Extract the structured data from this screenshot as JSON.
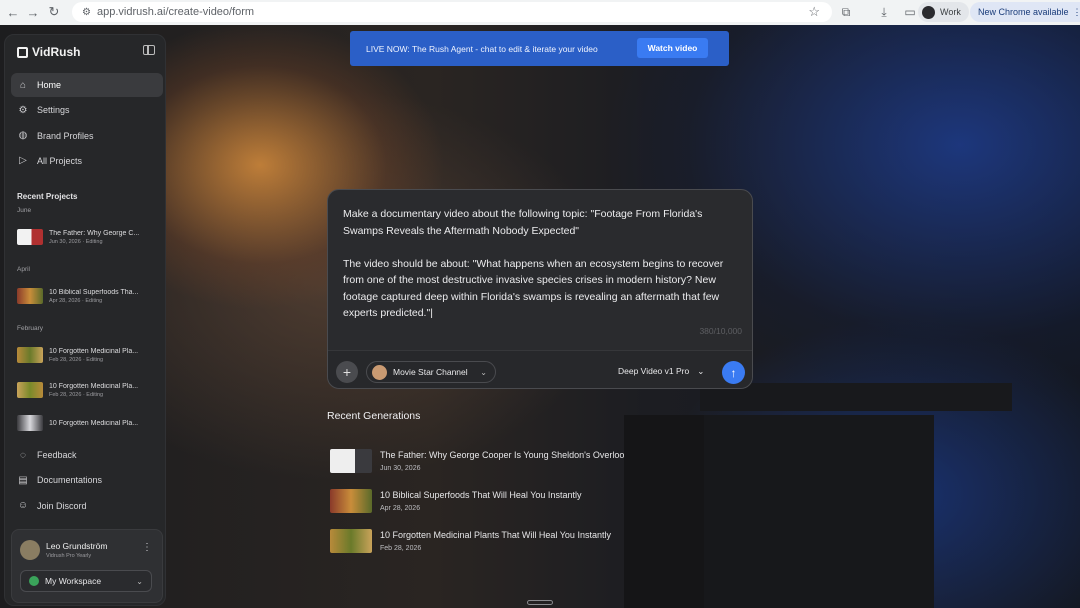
{
  "browser": {
    "url": "app.vidrush.ai/create-video/form",
    "profile_label": "Work",
    "update_label": "New Chrome available"
  },
  "sidebar": {
    "brand": "VidRush",
    "nav": [
      {
        "label": "Home",
        "icon": "home-icon"
      },
      {
        "label": "Settings",
        "icon": "gear-icon"
      },
      {
        "label": "Brand Profiles",
        "icon": "palette-icon"
      },
      {
        "label": "All Projects",
        "icon": "play-circle-icon"
      }
    ],
    "recent_title": "Recent Projects",
    "groups": [
      {
        "month": "June",
        "items": [
          {
            "name": "The Father: Why George C...",
            "meta": "Jun 30, 2026 · Editing"
          }
        ]
      },
      {
        "month": "April",
        "items": [
          {
            "name": "10 Biblical Superfoods Tha...",
            "meta": "Apr 28, 2026 · Editing"
          }
        ]
      },
      {
        "month": "February",
        "items": [
          {
            "name": "10 Forgotten Medicinal Pla...",
            "meta": "Feb 28, 2026 · Editing"
          },
          {
            "name": "10 Forgotten Medicinal Pla...",
            "meta": "Feb 28, 2026 · Editing"
          },
          {
            "name": "10 Forgotten Medicinal Pla...",
            "meta": ""
          }
        ]
      }
    ],
    "bottom_nav": [
      {
        "label": "Feedback",
        "icon": "chat-icon"
      },
      {
        "label": "Documentations",
        "icon": "document-icon"
      },
      {
        "label": "Join Discord",
        "icon": "discord-icon"
      }
    ],
    "user": {
      "name": "Leo Grundström",
      "plan": "Vidrush Pro Yearly",
      "workspace": "My Workspace"
    }
  },
  "banner": {
    "text": "LIVE NOW: The Rush Agent - chat to edit & iterate your video",
    "button": "Watch video"
  },
  "prompt": {
    "text": "Make a documentary video about the following topic: \"Footage From Florida's Swamps Reveals the Aftermath Nobody Expected\"\n\nThe video should be about: \"What happens when an ecosystem begins to recover from one of the most destructive invasive species crises in modern history? New footage captured deep within Florida's swamps is revealing an aftermath that few experts predicted.\"|",
    "counter": "380/10,000",
    "channel": "Movie Star Channel",
    "model": "Deep Video v1 Pro"
  },
  "recent_generations": {
    "title": "Recent Generations",
    "items": [
      {
        "name": "The Father: Why George Cooper Is Young Sheldon's Overloo",
        "date": "Jun 30, 2026"
      },
      {
        "name": "10 Biblical Superfoods That Will Heal You Instantly",
        "date": "Apr 28, 2026"
      },
      {
        "name": "10 Forgotten Medicinal Plants That Will Heal You Instantly",
        "date": "Feb 28, 2026"
      }
    ]
  },
  "colors": {
    "accent": "#3a7bf2",
    "banner": "#2b5fc7",
    "sidebar": "#262729"
  }
}
